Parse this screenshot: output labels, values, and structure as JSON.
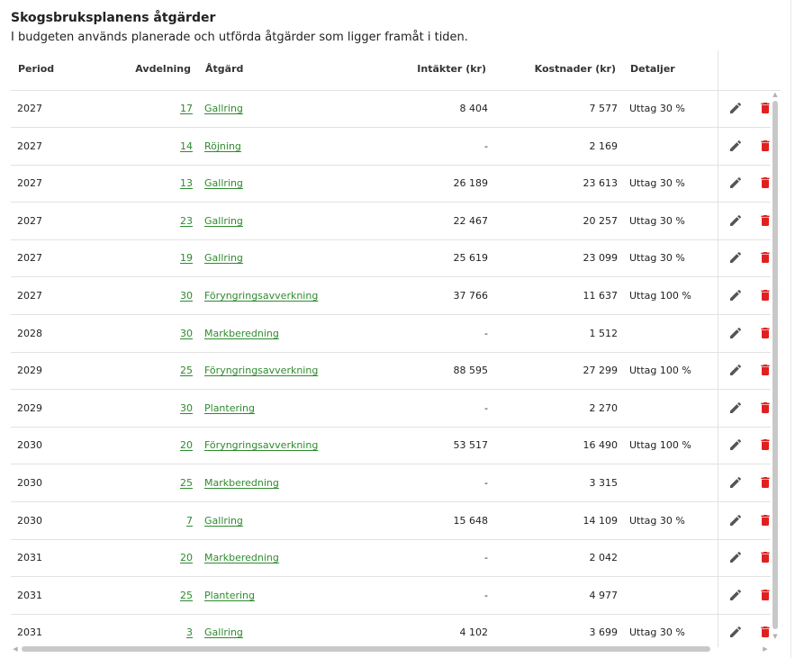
{
  "header": {
    "title": "Skogsbruksplanens åtgärder",
    "subtitle": "I budgeten används planerade och utförda åtgärder som ligger framåt i tiden."
  },
  "table": {
    "columns": {
      "period": "Period",
      "avdelning": "Avdelning",
      "atgard": "Åtgärd",
      "intakter": "Intäkter (kr)",
      "kostnader": "Kostnader (kr)",
      "detaljer": "Detaljer"
    },
    "rows": [
      {
        "period": "2027",
        "avdelning": "17",
        "atgard": "Gallring",
        "intakter": "8 404",
        "kostnader": "7 577",
        "detaljer": "Uttag 30 %"
      },
      {
        "period": "2027",
        "avdelning": "14",
        "atgard": "Röjning",
        "intakter": "-",
        "kostnader": "2 169",
        "detaljer": ""
      },
      {
        "period": "2027",
        "avdelning": "13",
        "atgard": "Gallring",
        "intakter": "26 189",
        "kostnader": "23 613",
        "detaljer": "Uttag 30 %"
      },
      {
        "period": "2027",
        "avdelning": "23",
        "atgard": "Gallring",
        "intakter": "22 467",
        "kostnader": "20 257",
        "detaljer": "Uttag 30 %"
      },
      {
        "period": "2027",
        "avdelning": "19",
        "atgard": "Gallring",
        "intakter": "25 619",
        "kostnader": "23 099",
        "detaljer": "Uttag 30 %"
      },
      {
        "period": "2027",
        "avdelning": "30",
        "atgard": "Föryngringsavverkning",
        "intakter": "37 766",
        "kostnader": "11 637",
        "detaljer": "Uttag 100 %"
      },
      {
        "period": "2028",
        "avdelning": "30",
        "atgard": "Markberedning",
        "intakter": "-",
        "kostnader": "1 512",
        "detaljer": ""
      },
      {
        "period": "2029",
        "avdelning": "25",
        "atgard": "Föryngringsavverkning",
        "intakter": "88 595",
        "kostnader": "27 299",
        "detaljer": "Uttag 100 %"
      },
      {
        "period": "2029",
        "avdelning": "30",
        "atgard": "Plantering",
        "intakter": "-",
        "kostnader": "2 270",
        "detaljer": ""
      },
      {
        "period": "2030",
        "avdelning": "20",
        "atgard": "Föryngringsavverkning",
        "intakter": "53 517",
        "kostnader": "16 490",
        "detaljer": "Uttag 100 %"
      },
      {
        "period": "2030",
        "avdelning": "25",
        "atgard": "Markberedning",
        "intakter": "-",
        "kostnader": "3 315",
        "detaljer": ""
      },
      {
        "period": "2030",
        "avdelning": "7",
        "atgard": "Gallring",
        "intakter": "15 648",
        "kostnader": "14 109",
        "detaljer": "Uttag 30 %"
      },
      {
        "period": "2031",
        "avdelning": "20",
        "atgard": "Markberedning",
        "intakter": "-",
        "kostnader": "2 042",
        "detaljer": ""
      },
      {
        "period": "2031",
        "avdelning": "25",
        "atgard": "Plantering",
        "intakter": "-",
        "kostnader": "4 977",
        "detaljer": ""
      },
      {
        "period": "2031",
        "avdelning": "3",
        "atgard": "Gallring",
        "intakter": "4 102",
        "kostnader": "3 699",
        "detaljer": "Uttag 30 %"
      }
    ],
    "row_actions": {
      "edit_icon": "pencil-icon",
      "delete_icon": "trash-icon"
    }
  },
  "colors": {
    "link": "#2e8b2e",
    "delete": "#e02020",
    "edit": "#555555",
    "divider": "#e2e2e2"
  }
}
